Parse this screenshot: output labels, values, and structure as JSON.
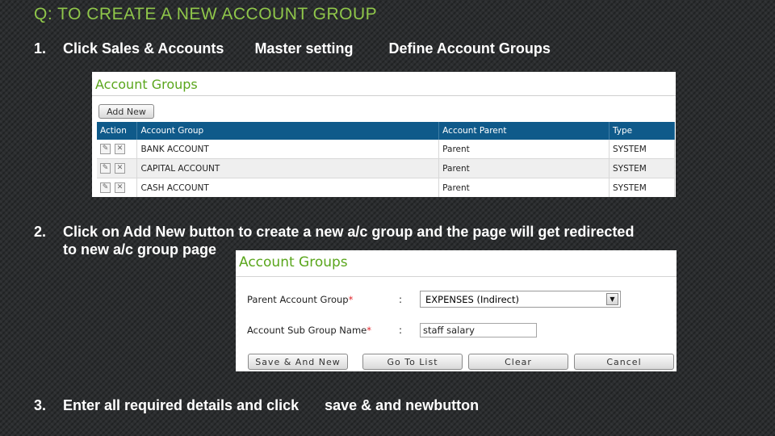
{
  "title": "Q: TO CREATE A NEW ACCOUNT GROUP",
  "steps": {
    "s1": {
      "num": "1.",
      "part1": "Click Sales & Accounts",
      "part2": "Master setting",
      "part3": "Define Account Groups"
    },
    "s2": {
      "num": "2.",
      "line1": "Click on Add New button to create a new a/c group and the page will get redirected",
      "line2": "to new a/c group page"
    },
    "s3": {
      "num": "3.",
      "part1": "Enter all required details and click",
      "part2": "save & and newbutton"
    }
  },
  "panel1": {
    "header": "Account Groups",
    "add_new_label": "Add New",
    "columns": [
      "Action",
      "Account Group",
      "Account Parent",
      "Type"
    ],
    "rows": [
      {
        "group": "BANK ACCOUNT",
        "parent": "Parent",
        "type": "SYSTEM"
      },
      {
        "group": "CAPITAL ACCOUNT",
        "parent": "Parent",
        "type": "SYSTEM"
      },
      {
        "group": "CASH ACCOUNT",
        "parent": "Parent",
        "type": "SYSTEM"
      }
    ]
  },
  "panel2": {
    "header": "Account Groups",
    "parent_label": "Parent Account Group",
    "parent_value": "EXPENSES (Indirect)",
    "sub_label": "Account Sub Group Name",
    "sub_value": "staff salary",
    "required_mark": "*",
    "colon": ":",
    "buttons": {
      "save_new": "Save & And New",
      "go_list": "Go To List",
      "clear": "Clear",
      "cancel": "Cancel"
    }
  },
  "colors": {
    "title": "#8fc64a",
    "header_green": "#5aa61c",
    "table_header": "#0f5a8a",
    "required": "#e0252b"
  },
  "icons": {
    "edit": "pencil-icon",
    "delete": "close-icon",
    "dropdown": "chevron-down-icon",
    "arrow": "arrow-icon"
  }
}
